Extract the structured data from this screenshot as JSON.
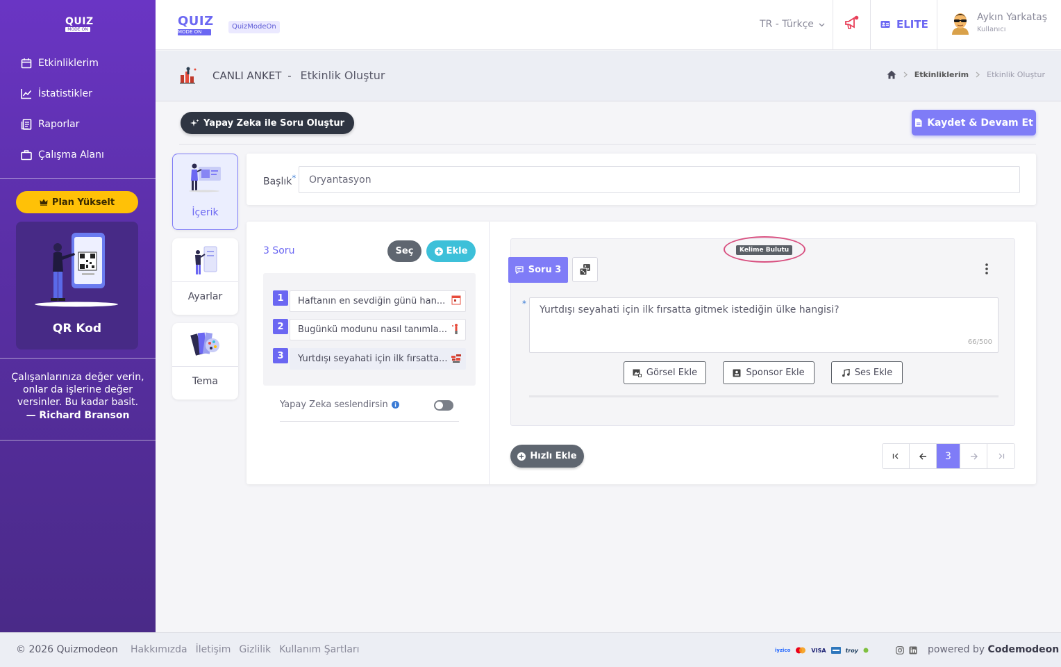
{
  "sidebar": {
    "logo": {
      "text": "QUIZ",
      "sub": "MODE ON"
    },
    "menu": [
      {
        "label": "Etkinliklerim",
        "icon": "calendar-icon"
      },
      {
        "label": "İstatistikler",
        "icon": "chart-line-icon"
      },
      {
        "label": "Raporlar",
        "icon": "report-icon"
      },
      {
        "label": "Çalışma Alanı",
        "icon": "briefcase-icon"
      }
    ],
    "plan_button": "Plan Yükselt",
    "qr_card_title": "QR Kod",
    "quote": {
      "text": "Çalışanlarınıza değer verin, onlar da işlerine değer versinler. Bu kadar basit.",
      "author": "— Richard Branson"
    }
  },
  "topbar": {
    "logo": {
      "text": "QUIZ",
      "sub": "MODE ON"
    },
    "badge": "QuizModeOn",
    "language": "TR - Türkçe",
    "plan": "ELITE",
    "user": {
      "name": "Aykın Yarkataş",
      "role": "Kullanıcı"
    }
  },
  "page_header": {
    "activity_type": "CANLI ANKET",
    "separator": "-",
    "title": "Etkinlik Oluştur",
    "breadcrumb": [
      "Etkinliklerim",
      "Etkinlik Oluştur"
    ]
  },
  "toolbar": {
    "ai_button": "Yapay Zeka ile Soru Oluştur",
    "save_button": "Kaydet & Devam Et"
  },
  "side_tabs": [
    {
      "label": "İçerik",
      "active": true
    },
    {
      "label": "Ayarlar",
      "active": false
    },
    {
      "label": "Tema",
      "active": false
    }
  ],
  "title_field": {
    "label": "Başlık",
    "required_mark": "*",
    "value": "Oryantasyon"
  },
  "questions": {
    "count_label": "3 Soru",
    "select_button": "Seç",
    "add_button": "Ekle",
    "items": [
      {
        "num": "1",
        "text": "Haftanın en sevdiğin günü han..."
      },
      {
        "num": "2",
        "text": "Bugünkü modunu nasıl tanımla..."
      },
      {
        "num": "3",
        "text": "Yurtdışı seyahati için ilk fırsatta..."
      }
    ],
    "ai_voice_label": "Yapay Zeka seslendirsin",
    "ai_voice_enabled": false
  },
  "editor": {
    "question_type": "Kelime Bulutu",
    "question_tab": "Soru 3",
    "required_mark": "*",
    "question_text": "Yurtdışı seyahati için ilk fırsatta gitmek istediğin ülke hangisi?",
    "char_counter": "66/500",
    "media_buttons": [
      "Görsel Ekle",
      "Sponsor Ekle",
      "Ses Ekle"
    ],
    "quick_add_button": "Hızlı Ekle",
    "pagination": {
      "current_page": "3"
    }
  },
  "footer": {
    "copyright": "© 2026 Quizmodeon",
    "links": [
      "Hakkımızda",
      "İletişim",
      "Gizlilik",
      "Kullanım Şartları"
    ],
    "payment_logos": [
      "iyzico",
      "mastercard",
      "VISA",
      "amex",
      "troy"
    ],
    "powered_prefix": "powered by",
    "powered_brand": "Codemodeon"
  },
  "colors": {
    "sidebar_top": "#6a35c4",
    "sidebar_bottom": "#4a2a88",
    "accent": "#7f7cf7",
    "plan_button": "#ffc107",
    "add_button": "#3dc0d9",
    "dark_button": "#2f3542",
    "annotation_circle": "#d85080"
  }
}
